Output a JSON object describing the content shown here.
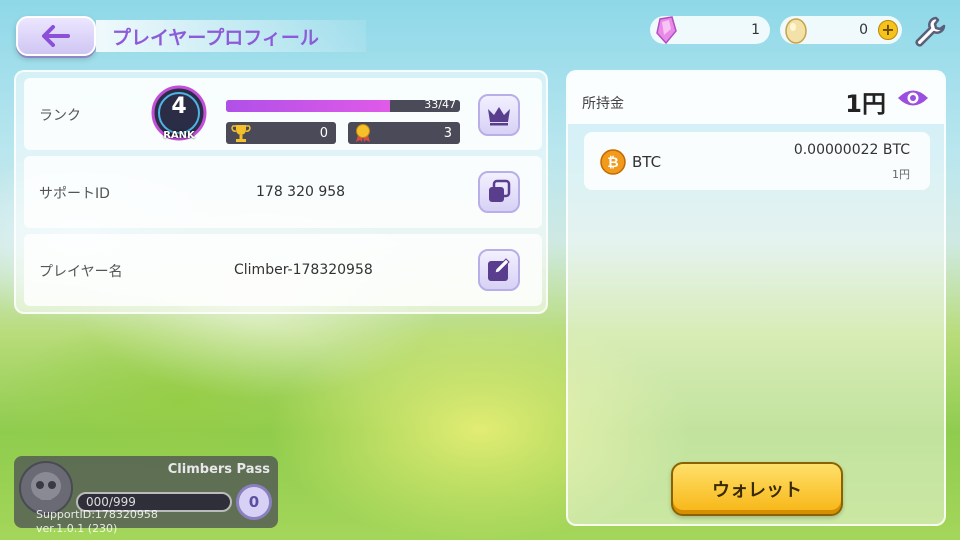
{
  "header": {
    "title": "プレイヤープロフィール"
  },
  "resources": {
    "gems": "1",
    "eggs": "0"
  },
  "profile": {
    "rank_label": "ランク",
    "rank_value": "4",
    "rank_badge_text": "RANK",
    "rank_progress_text": "33/47",
    "rank_progress_fraction": 0.702,
    "trophies": "0",
    "medals": "3",
    "support_id_label": "サポートID",
    "support_id_value": "178 320 958",
    "player_name_label": "プレイヤー名",
    "player_name_value": "Climber-178320958"
  },
  "wallet": {
    "balance_label": "所持金",
    "balance_value": "1円",
    "coin_name": "BTC",
    "coin_amount": "0.00000022 BTC",
    "coin_yen": "1円",
    "wallet_button": "ウォレット"
  },
  "pass": {
    "title": "Climbers Pass",
    "progress": "000/999",
    "level": "0",
    "support_id_text": "SupportID:178320958",
    "version_text": "ver.1.0.1 (230)"
  },
  "colors": {
    "accent": "#8e5bd8",
    "progress": "#c055e8",
    "wallet_button": "#f7b514"
  },
  "icons": {
    "back": "arrow-left-icon",
    "gem": "gem-icon",
    "egg": "egg-icon",
    "settings": "wrench-icon",
    "crown": "crown-icon",
    "copy": "copy-icon",
    "edit": "edit-icon",
    "eye": "eye-icon",
    "bitcoin": "bitcoin-icon",
    "trophy": "trophy-icon",
    "medal": "medal-icon",
    "skull": "skull-icon"
  }
}
